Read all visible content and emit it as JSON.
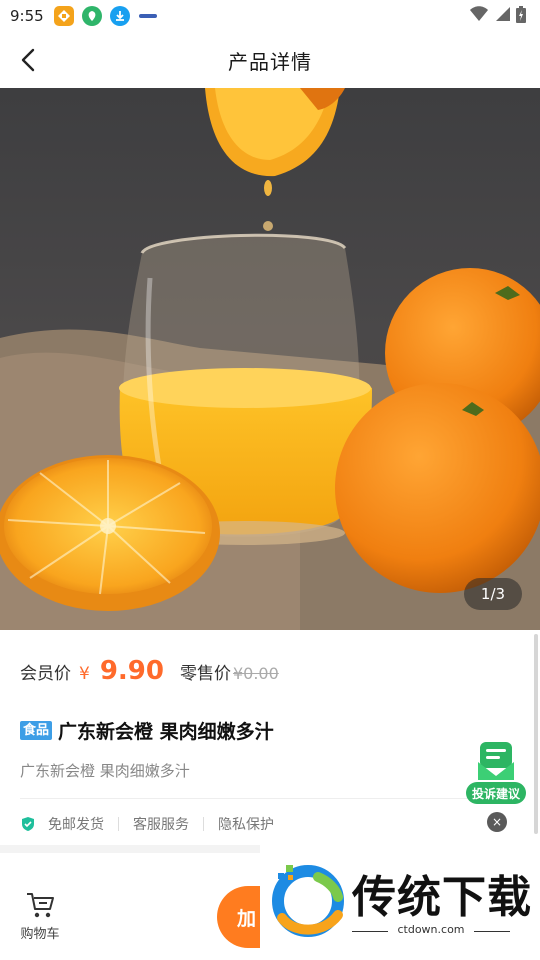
{
  "status_bar": {
    "time": "9:55",
    "apps": [
      {
        "icon": "app-badge-icon",
        "color": "#f4a31b"
      },
      {
        "icon": "shield-leaf-icon",
        "color": "#2fb56a"
      },
      {
        "icon": "download-icon",
        "color": "#18a0f0"
      },
      {
        "icon": "app-logo-icon",
        "color": "#3b5fb5"
      }
    ],
    "wifi": "wifi-icon",
    "signal": "signal-icon",
    "battery": "battery-icon"
  },
  "header": {
    "title": "产品详情",
    "back_icon": "chevron-left-icon"
  },
  "gallery": {
    "counter": "1/3",
    "description_icon": "orange-juice-photo"
  },
  "price": {
    "member_label": "会员价",
    "currency": "¥",
    "member_price": "9.90",
    "retail_label": "零售价",
    "retail_price": "¥0.00",
    "accent_color": "#ff6a2b"
  },
  "product": {
    "category_tag": "食品",
    "title": "广东新会橙 果肉细嫩多汁",
    "subtitle": "广东新会橙 果肉细嫩多汁"
  },
  "services": [
    "免邮发货",
    "客服服务",
    "隐私保护"
  ],
  "bottom_bar": {
    "cart_label": "购物车",
    "add_button_label": "加"
  },
  "complaint": {
    "label": "投诉建议",
    "close": "×"
  },
  "watermark": {
    "text": "传统下载",
    "url": "ctdown.com"
  }
}
